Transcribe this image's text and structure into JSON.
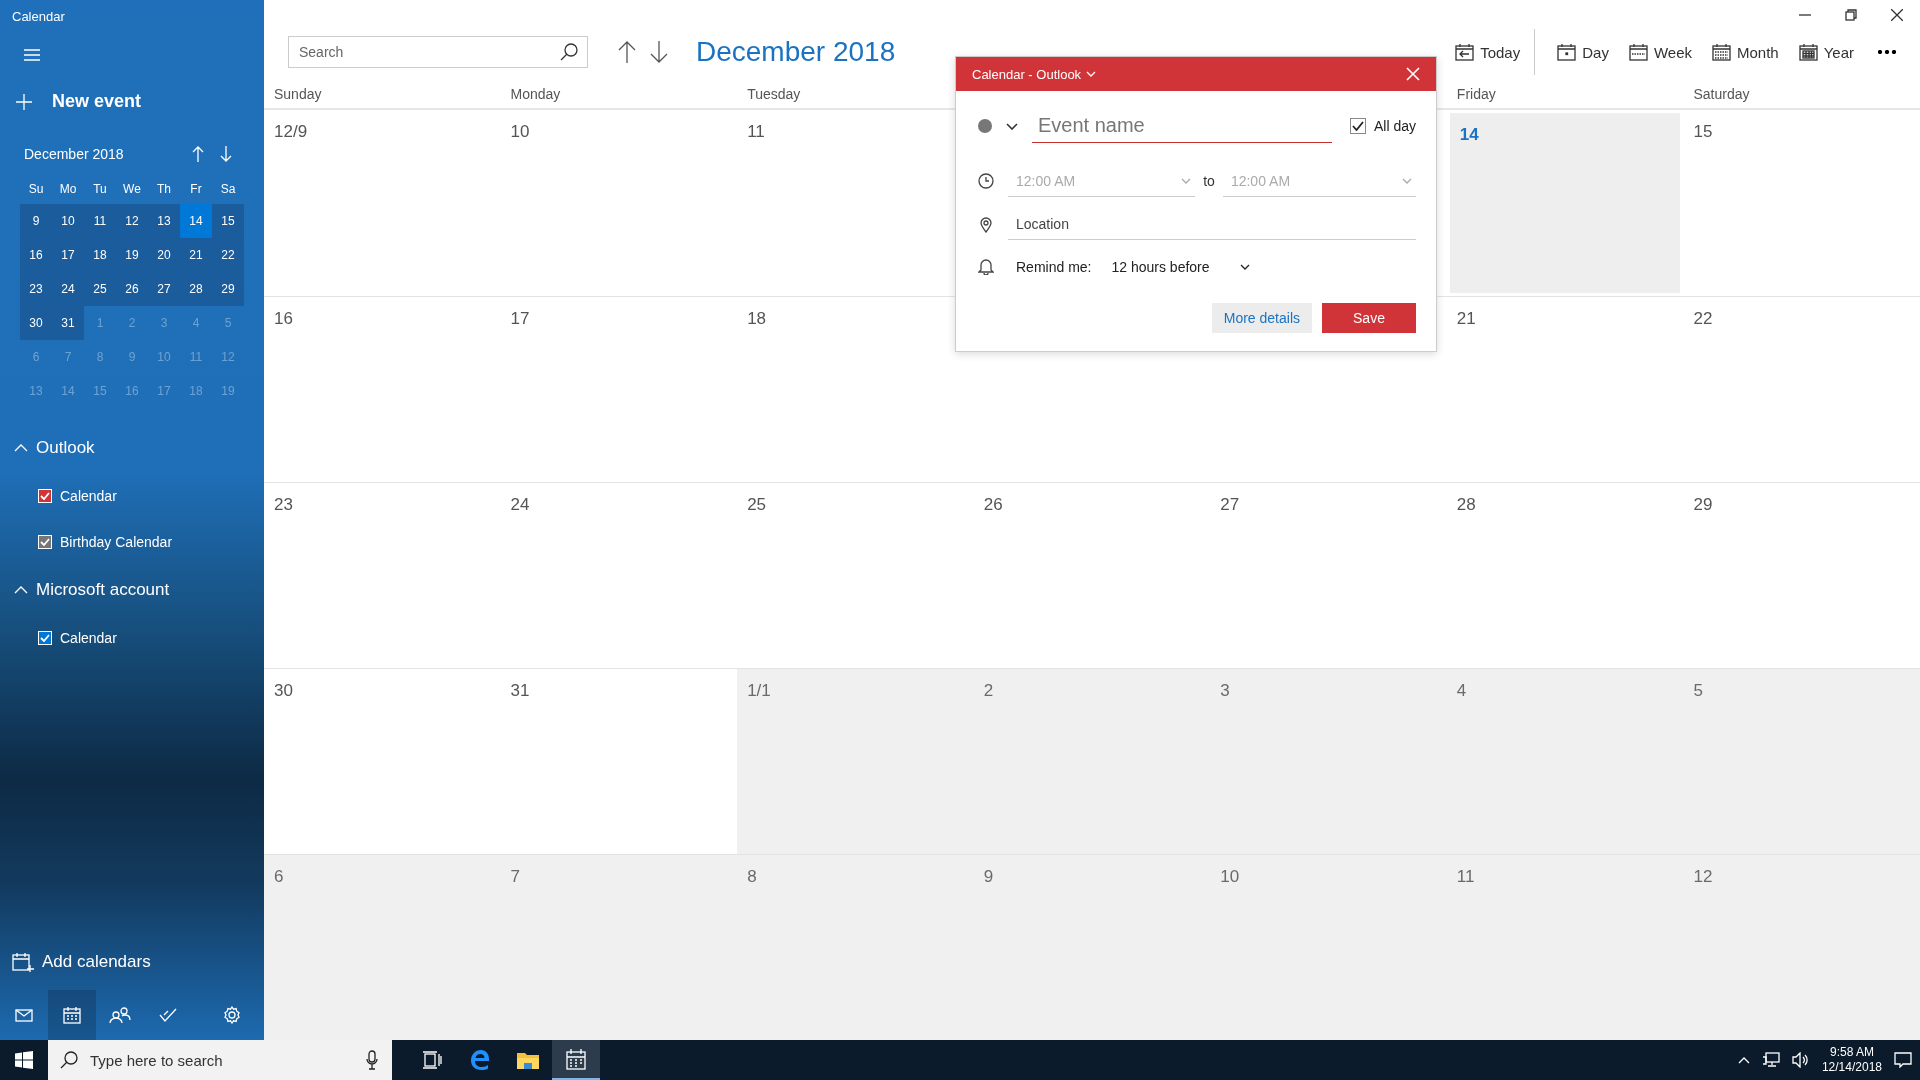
{
  "window": {
    "title": "Calendar"
  },
  "sidebar": {
    "new_event": "New event",
    "mini_calendar": {
      "title": "December 2018",
      "weekdays": [
        "Su",
        "Mo",
        "Tu",
        "We",
        "Th",
        "Fr",
        "Sa"
      ],
      "weeks": [
        [
          {
            "day": "9",
            "in_month": true,
            "today": false
          },
          {
            "day": "10",
            "in_month": true,
            "today": false
          },
          {
            "day": "11",
            "in_month": true,
            "today": false
          },
          {
            "day": "12",
            "in_month": true,
            "today": false
          },
          {
            "day": "13",
            "in_month": true,
            "today": false
          },
          {
            "day": "14",
            "in_month": true,
            "today": true
          },
          {
            "day": "15",
            "in_month": true,
            "today": false
          }
        ],
        [
          {
            "day": "16",
            "in_month": true,
            "today": false
          },
          {
            "day": "17",
            "in_month": true,
            "today": false
          },
          {
            "day": "18",
            "in_month": true,
            "today": false
          },
          {
            "day": "19",
            "in_month": true,
            "today": false
          },
          {
            "day": "20",
            "in_month": true,
            "today": false
          },
          {
            "day": "21",
            "in_month": true,
            "today": false
          },
          {
            "day": "22",
            "in_month": true,
            "today": false
          }
        ],
        [
          {
            "day": "23",
            "in_month": true,
            "today": false
          },
          {
            "day": "24",
            "in_month": true,
            "today": false
          },
          {
            "day": "25",
            "in_month": true,
            "today": false
          },
          {
            "day": "26",
            "in_month": true,
            "today": false
          },
          {
            "day": "27",
            "in_month": true,
            "today": false
          },
          {
            "day": "28",
            "in_month": true,
            "today": false
          },
          {
            "day": "29",
            "in_month": true,
            "today": false
          }
        ],
        [
          {
            "day": "30",
            "in_month": true,
            "today": false
          },
          {
            "day": "31",
            "in_month": true,
            "today": false
          },
          {
            "day": "1",
            "in_month": false,
            "today": false
          },
          {
            "day": "2",
            "in_month": false,
            "today": false
          },
          {
            "day": "3",
            "in_month": false,
            "today": false
          },
          {
            "day": "4",
            "in_month": false,
            "today": false
          },
          {
            "day": "5",
            "in_month": false,
            "today": false
          }
        ],
        [
          {
            "day": "6",
            "in_month": false,
            "today": false
          },
          {
            "day": "7",
            "in_month": false,
            "today": false
          },
          {
            "day": "8",
            "in_month": false,
            "today": false
          },
          {
            "day": "9",
            "in_month": false,
            "today": false
          },
          {
            "day": "10",
            "in_month": false,
            "today": false
          },
          {
            "day": "11",
            "in_month": false,
            "today": false
          },
          {
            "day": "12",
            "in_month": false,
            "today": false
          }
        ],
        [
          {
            "day": "13",
            "in_month": false,
            "today": false
          },
          {
            "day": "14",
            "in_month": false,
            "today": false
          },
          {
            "day": "15",
            "in_month": false,
            "today": false
          },
          {
            "day": "16",
            "in_month": false,
            "today": false
          },
          {
            "day": "17",
            "in_month": false,
            "today": false
          },
          {
            "day": "18",
            "in_month": false,
            "today": false
          },
          {
            "day": "19",
            "in_month": false,
            "today": false
          }
        ]
      ]
    },
    "groups": [
      {
        "name": "Outlook",
        "expanded": true,
        "calendars": [
          {
            "name": "Calendar",
            "checked": true,
            "color": "#d13438"
          },
          {
            "name": "Birthday Calendar",
            "checked": true,
            "color": "#767676"
          }
        ]
      },
      {
        "name": "Microsoft account",
        "expanded": true,
        "calendars": [
          {
            "name": "Calendar",
            "checked": true,
            "color": "#0078d7"
          }
        ]
      }
    ],
    "add_calendars": "Add calendars",
    "nav": [
      {
        "kind": "mail",
        "selected": false
      },
      {
        "kind": "calendar",
        "selected": true
      },
      {
        "kind": "people",
        "selected": false
      },
      {
        "kind": "todo",
        "selected": false
      },
      {
        "kind": "settings",
        "selected": false
      }
    ]
  },
  "toolbar": {
    "search": {
      "placeholder": "Search"
    },
    "title": "December 2018",
    "views": [
      {
        "kind": "today",
        "label": "Today"
      },
      {
        "kind": "day",
        "label": "Day"
      },
      {
        "kind": "week",
        "label": "Week"
      },
      {
        "kind": "month",
        "label": "Month"
      },
      {
        "kind": "year",
        "label": "Year"
      }
    ]
  },
  "month_grid": {
    "weekdays": {
      "before_popup": [
        "Sunday",
        "Monday",
        "Tuesday"
      ],
      "after_popup": [
        "Friday",
        "Saturday"
      ]
    },
    "weeks": [
      {
        "before_popup": [
          {
            "label": "12/9",
            "in_month": true,
            "today": false
          },
          {
            "label": "10",
            "in_month": true,
            "today": false
          },
          {
            "label": "11",
            "in_month": true,
            "today": false
          }
        ],
        "after_popup": [
          {
            "label": "14",
            "in_month": true,
            "today": true
          },
          {
            "label": "15",
            "in_month": true,
            "today": false
          }
        ]
      },
      {
        "before_popup": [
          {
            "label": "16",
            "in_month": true,
            "today": false
          },
          {
            "label": "17",
            "in_month": true,
            "today": false
          },
          {
            "label": "18",
            "in_month": true,
            "today": false
          }
        ],
        "after_popup": [
          {
            "label": "21",
            "in_month": true,
            "today": false
          },
          {
            "label": "22",
            "in_month": true,
            "today": false
          }
        ]
      },
      {
        "cells": [
          {
            "label": "23",
            "in_month": true,
            "today": false
          },
          {
            "label": "24",
            "in_month": true,
            "today": false
          },
          {
            "label": "25",
            "in_month": true,
            "today": false
          },
          {
            "label": "26",
            "in_month": true,
            "today": false
          },
          {
            "label": "27",
            "in_month": true,
            "today": false
          },
          {
            "label": "28",
            "in_month": true,
            "today": false
          },
          {
            "label": "29",
            "in_month": true,
            "today": false
          }
        ]
      },
      {
        "cells": [
          {
            "label": "30",
            "in_month": true,
            "today": false
          },
          {
            "label": "31",
            "in_month": true,
            "today": false
          },
          {
            "label": "1/1",
            "in_month": false,
            "today": false
          },
          {
            "label": "2",
            "in_month": false,
            "today": false
          },
          {
            "label": "3",
            "in_month": false,
            "today": false
          },
          {
            "label": "4",
            "in_month": false,
            "today": false
          },
          {
            "label": "5",
            "in_month": false,
            "today": false
          }
        ]
      },
      {
        "cells": [
          {
            "label": "6",
            "in_month": false,
            "today": false
          },
          {
            "label": "7",
            "in_month": false,
            "today": false
          },
          {
            "label": "8",
            "in_month": false,
            "today": false
          },
          {
            "label": "9",
            "in_month": false,
            "today": false
          },
          {
            "label": "10",
            "in_month": false,
            "today": false
          },
          {
            "label": "11",
            "in_month": false,
            "today": false
          },
          {
            "label": "12",
            "in_month": false,
            "today": false
          }
        ]
      }
    ]
  },
  "popup": {
    "account": "Calendar - Outlook",
    "event_name": {
      "placeholder": "Event name"
    },
    "all_day": {
      "label": "All day",
      "checked": true
    },
    "start": {
      "value": "12:00 AM",
      "disabled": true
    },
    "to": "to",
    "end": {
      "value": "12:00 AM",
      "disabled": true
    },
    "location": {
      "placeholder": "Location"
    },
    "remind_label": "Remind me:",
    "remind_value": "12 hours before",
    "buttons": [
      {
        "label": "More details",
        "kind": "secondary"
      },
      {
        "label": "Save",
        "kind": "primary"
      }
    ]
  },
  "taskbar": {
    "search": {
      "placeholder": "Type here to search"
    },
    "apps": [
      {
        "kind": "task-view",
        "active": false
      },
      {
        "kind": "browser",
        "active": false
      },
      {
        "kind": "folder",
        "active": false
      },
      {
        "kind": "calendar",
        "active": true
      }
    ],
    "clock": {
      "time": "9:58 AM",
      "date": "12/14/2018"
    }
  }
}
